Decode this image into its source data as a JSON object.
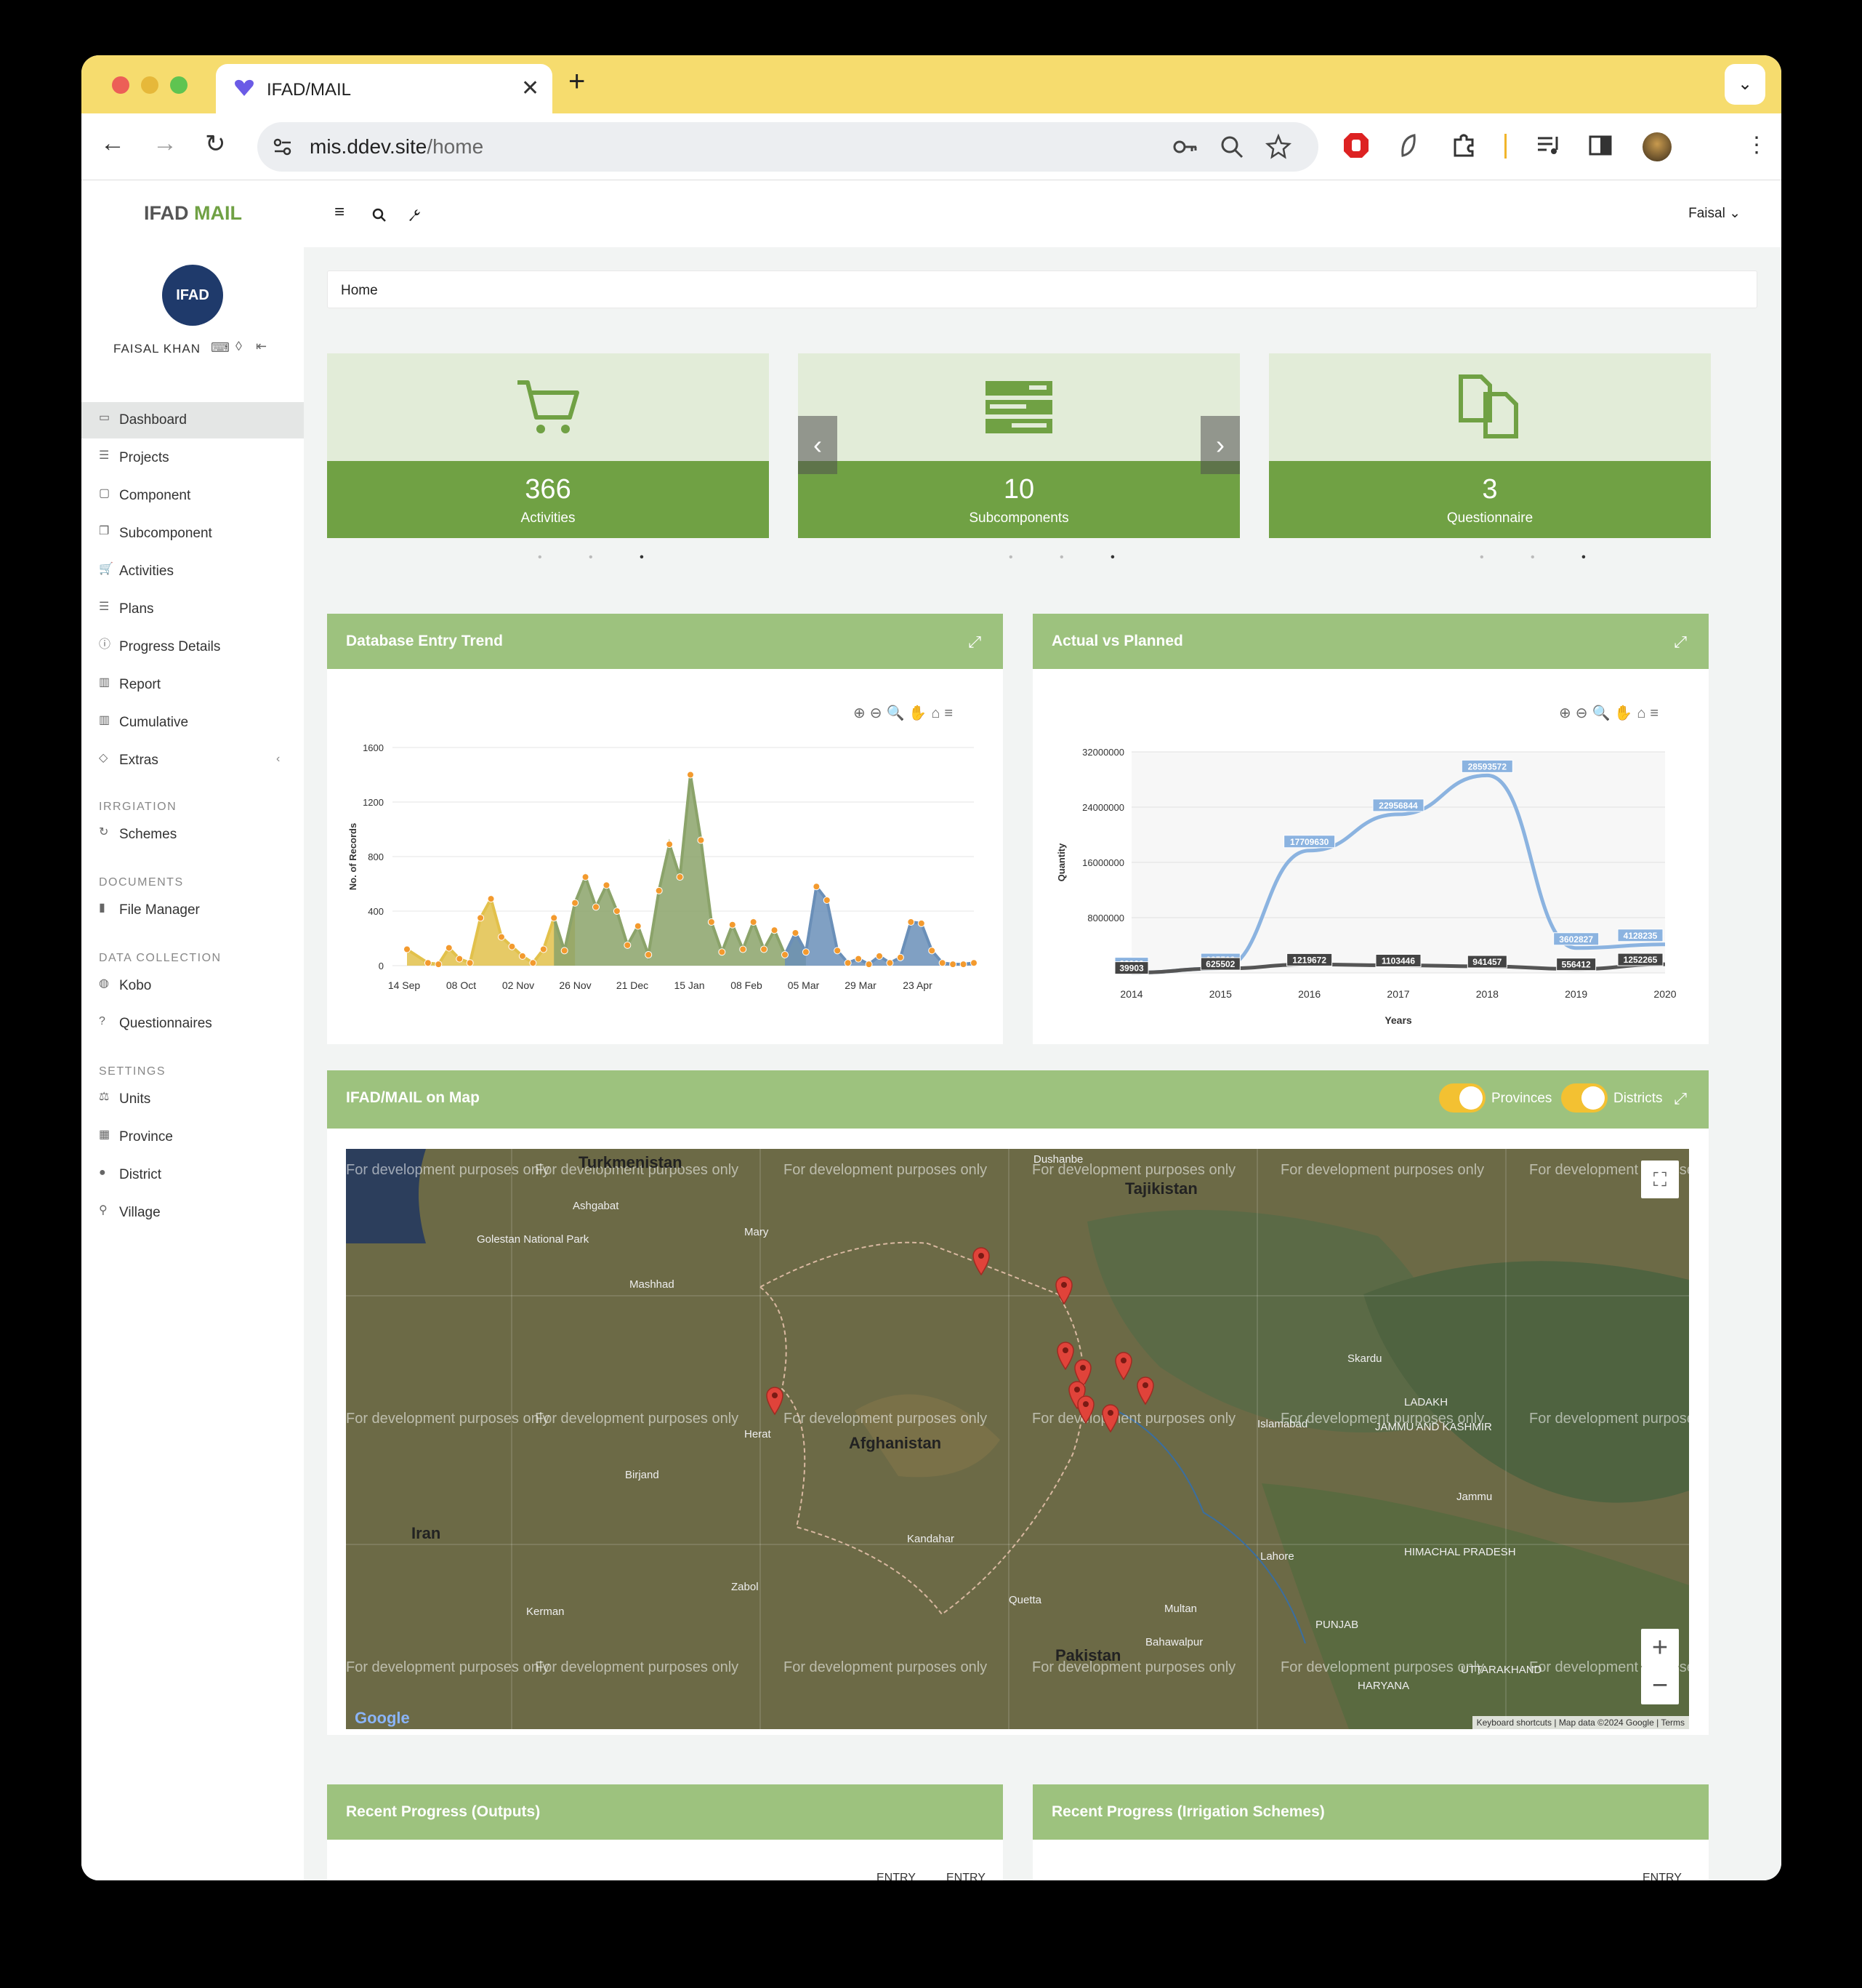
{
  "browser": {
    "tab_title": "IFAD/MAIL",
    "url_host": "mis.ddev.site",
    "url_path": "/home"
  },
  "app": {
    "brand_part1": "IFAD",
    "brand_part2": "MAIL",
    "user_menu": "Faisal",
    "avatar_text": "IFAD",
    "user_name": "FAISAL KHAN"
  },
  "sidebar": {
    "items": [
      {
        "label": "Dashboard",
        "icon": "dashboard-icon"
      },
      {
        "label": "Projects",
        "icon": "list-icon"
      },
      {
        "label": "Component",
        "icon": "window-icon"
      },
      {
        "label": "Subcomponent",
        "icon": "clone-icon"
      },
      {
        "label": "Activities",
        "icon": "cart-icon"
      },
      {
        "label": "Plans",
        "icon": "list-icon"
      },
      {
        "label": "Progress Details",
        "icon": "info-icon"
      },
      {
        "label": "Report",
        "icon": "bar-chart-icon"
      },
      {
        "label": "Cumulative",
        "icon": "bar-chart-icon"
      },
      {
        "label": "Extras",
        "icon": "tag-icon"
      }
    ],
    "sections": [
      {
        "title": "IRRGIATION",
        "items": [
          {
            "label": "Schemes",
            "icon": "refresh-icon"
          }
        ]
      },
      {
        "title": "DOCUMENTS",
        "items": [
          {
            "label": "File Manager",
            "icon": "file-icon"
          }
        ]
      },
      {
        "title": "DATA COLLECTION",
        "items": [
          {
            "label": "Kobo",
            "icon": "globe-icon"
          },
          {
            "label": "Questionnaires",
            "icon": "question-icon"
          }
        ]
      },
      {
        "title": "SETTINGS",
        "items": [
          {
            "label": "Units",
            "icon": "scale-icon"
          },
          {
            "label": "Province",
            "icon": "map-icon"
          },
          {
            "label": "District",
            "icon": "pin-icon"
          },
          {
            "label": "Village",
            "icon": "pushpin-icon"
          }
        ]
      }
    ]
  },
  "breadcrumb": "Home",
  "cards": [
    {
      "value": "366",
      "label": "Activities",
      "icon": "cart-icon"
    },
    {
      "value": "10",
      "label": "Subcomponents",
      "icon": "server-icon"
    },
    {
      "value": "3",
      "label": "Questionnaire",
      "icon": "copy-icon"
    }
  ],
  "panels": {
    "trend": "Database Entry Trend",
    "actual": "Actual vs Planned",
    "map": "IFAD/MAIL on Map",
    "outputs": "Recent Progress (Outputs)",
    "irrigation": "Recent Progress (Irrigation Schemes)"
  },
  "toggles": {
    "provinces": "Provinces",
    "districts": "Districts"
  },
  "table_headers": {
    "outputs": [
      "ENTRY",
      "ENTRY"
    ],
    "irrigation": [
      "ENTRY"
    ]
  },
  "map": {
    "watermark": "For development purposes only",
    "attribution": [
      "Keyboard shortcuts",
      "Map data ©2024 Google",
      "Terms"
    ],
    "countries": [
      "Turkmenistan",
      "Tajikistan",
      "Afghanistan",
      "Iran",
      "Pakistan"
    ],
    "places": [
      "Ashgabat",
      "Mashhad",
      "Dushanbe",
      "Islamabad",
      "Kandahar",
      "Lahore",
      "Multan",
      "Herat",
      "Mary",
      "Golestan National Park",
      "LADAKH",
      "JAMMU AND KASHMIR",
      "PUNJAB",
      "HIMACHAL PRADESH",
      "Quetta",
      "Zabol",
      "Kerman",
      "Birjand",
      "Jammu",
      "Skardu",
      "Bahawalpur",
      "HARYANA",
      "UTTARAKHAND"
    ]
  },
  "chart_data": [
    {
      "type": "line",
      "title": "Database Entry Trend",
      "ylabel": "No. of Records",
      "ylim": [
        0,
        1600
      ],
      "yticks": [
        0,
        400,
        800,
        1200,
        1600
      ],
      "xticks": [
        "14 Sep",
        "08 Oct",
        "02 Nov",
        "26 Nov",
        "21 Dec",
        "15 Jan",
        "08 Feb",
        "05 Mar",
        "29 Mar",
        "23 Apr"
      ],
      "points": [
        [
          0,
          120
        ],
        [
          2,
          20
        ],
        [
          3,
          10
        ],
        [
          4,
          130
        ],
        [
          5,
          50
        ],
        [
          6,
          20
        ],
        [
          7,
          350
        ],
        [
          8,
          490
        ],
        [
          9,
          210
        ],
        [
          10,
          140
        ],
        [
          11,
          70
        ],
        [
          12,
          20
        ],
        [
          13,
          120
        ],
        [
          14,
          350
        ],
        [
          15,
          110
        ],
        [
          16,
          460
        ],
        [
          17,
          650
        ],
        [
          18,
          430
        ],
        [
          19,
          590
        ],
        [
          20,
          400
        ],
        [
          21,
          150
        ],
        [
          22,
          290
        ],
        [
          23,
          80
        ],
        [
          24,
          550
        ],
        [
          25,
          890
        ],
        [
          26,
          650
        ],
        [
          27,
          1400
        ],
        [
          28,
          920
        ],
        [
          29,
          320
        ],
        [
          30,
          100
        ],
        [
          31,
          300
        ],
        [
          32,
          120
        ],
        [
          33,
          320
        ],
        [
          34,
          120
        ],
        [
          35,
          260
        ],
        [
          36,
          80
        ],
        [
          37,
          240
        ],
        [
          38,
          100
        ],
        [
          39,
          580
        ],
        [
          40,
          480
        ],
        [
          41,
          110
        ],
        [
          42,
          20
        ],
        [
          43,
          50
        ],
        [
          44,
          10
        ],
        [
          45,
          70
        ],
        [
          46,
          20
        ],
        [
          47,
          60
        ],
        [
          48,
          320
        ],
        [
          49,
          310
        ],
        [
          50,
          110
        ],
        [
          51,
          20
        ],
        [
          52,
          10
        ],
        [
          53,
          10
        ],
        [
          54,
          20
        ]
      ],
      "series_colors": [
        "#e2c14b",
        "#8ba36a",
        "#6a8fb8"
      ]
    },
    {
      "type": "line",
      "title": "Actual vs Planned",
      "xlabel": "Years",
      "ylabel": "Quantity",
      "ylim": [
        0,
        32000000
      ],
      "yticks": [
        0,
        8000000,
        16000000,
        24000000,
        32000000
      ],
      "categories": [
        "2014",
        "2015",
        "2016",
        "2017",
        "2018",
        "2019",
        "2020"
      ],
      "series": [
        {
          "values": [
            39903,
            625502,
            17709630,
            22956844,
            28593572,
            3602827,
            4128235
          ],
          "color": "#8bb3e0"
        },
        {
          "values": [
            39903,
            625502,
            1219672,
            1103446,
            941457,
            556412,
            1252265
          ],
          "color": "#555555"
        }
      ]
    }
  ]
}
